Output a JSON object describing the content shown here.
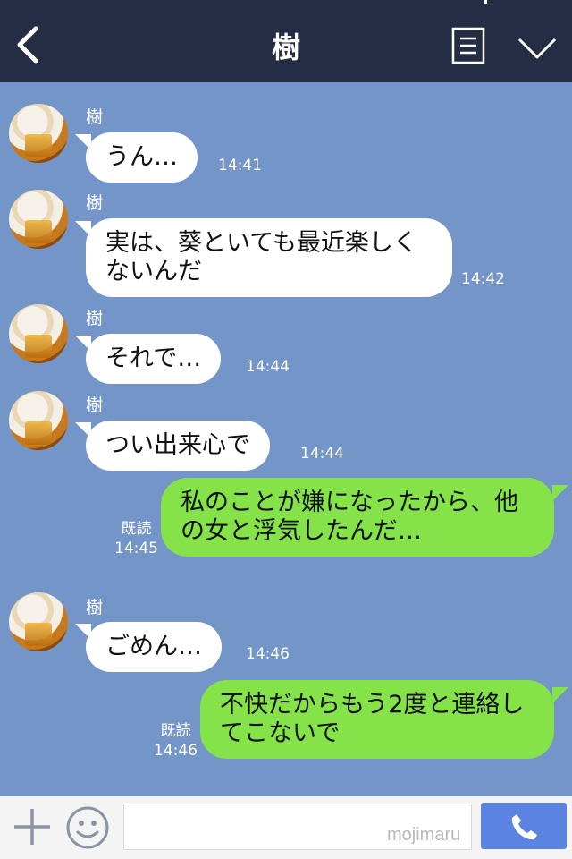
{
  "header": {
    "title": "樹",
    "back_icon": "chevron-left-icon",
    "menu_icon": "menu-list-icon",
    "collapse_icon": "chevron-down-icon",
    "background": "#242d44"
  },
  "chat": {
    "background": "#7495c8",
    "messages": [
      {
        "direction": "in",
        "sender": "樹",
        "text": "うん…",
        "time": "14:41"
      },
      {
        "direction": "in",
        "sender": "樹",
        "text": "実は、葵といても最近楽しくないんだ",
        "time": "14:42"
      },
      {
        "direction": "in",
        "sender": "樹",
        "text": "それで…",
        "time": "14:44"
      },
      {
        "direction": "in",
        "sender": "樹",
        "text": "つい出来心で",
        "time": "14:44"
      },
      {
        "direction": "out",
        "text": "私のことが嫌になったから、他の女と浮気したんだ…",
        "read": "既読",
        "time": "14:45"
      },
      {
        "direction": "in",
        "sender": "樹",
        "text": "ごめん…",
        "time": "14:46"
      },
      {
        "direction": "out",
        "text": "不快だからもう2度と連絡してこないで",
        "read": "既読",
        "time": "14:46"
      }
    ]
  },
  "composer": {
    "plus_icon": "plus-icon",
    "emoji_icon": "smiley-icon",
    "watermark": "mojimaru",
    "send_icon": "phone-icon"
  },
  "colors": {
    "incoming_bubble": "#ffffff",
    "outgoing_bubble": "#85e249",
    "send_button": "#5b84e2"
  }
}
